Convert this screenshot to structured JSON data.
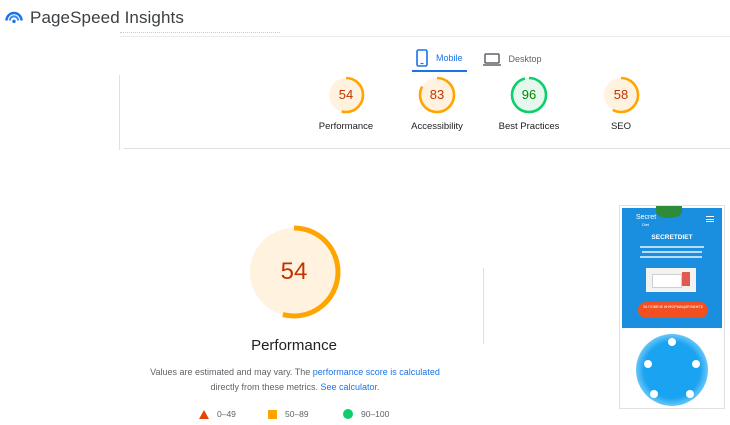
{
  "app": {
    "title": "PageSpeed Insights",
    "logo_icon": "pagespeed-logo-icon"
  },
  "device_tabs": [
    {
      "label": "Mobile",
      "icon": "smartphone-icon",
      "active": true
    },
    {
      "label": "Desktop",
      "icon": "desktop-icon",
      "active": false
    }
  ],
  "scores": [
    {
      "value": "54",
      "label": "Performance",
      "status": "average"
    },
    {
      "value": "83",
      "label": "Accessibility",
      "status": "average"
    },
    {
      "value": "96",
      "label": "Best Practices",
      "status": "good"
    },
    {
      "value": "58",
      "label": "SEO",
      "status": "average"
    }
  ],
  "performance": {
    "score": "54",
    "title": "Performance",
    "desc_part1": "Values are estimated and may vary. The ",
    "desc_link1": "performance score is calculated",
    "desc_part2": " directly from these metrics. ",
    "desc_link2": "See calculator."
  },
  "legend": [
    {
      "range": "0–49",
      "icon": "triangle-icon"
    },
    {
      "range": "50–89",
      "icon": "square-icon"
    },
    {
      "range": "90–100",
      "icon": "circle-icon"
    }
  ],
  "thumbnail": {
    "brand": "Secret",
    "brand_sub": "Diet",
    "heading": "SECRETDIET",
    "cta": "ЗА ПОВЕЧЕ ИНФОРМАЦИЯ ВИЖТЕ"
  },
  "colors": {
    "fail": "#c33300",
    "average_ring": "#ffa400",
    "average_text": "#c33300",
    "average_bg": "#fff3e0",
    "good_ring": "#0cce6b",
    "good_text": "#008800",
    "good_bg": "#e6f8ee",
    "link": "#1a73e8"
  }
}
